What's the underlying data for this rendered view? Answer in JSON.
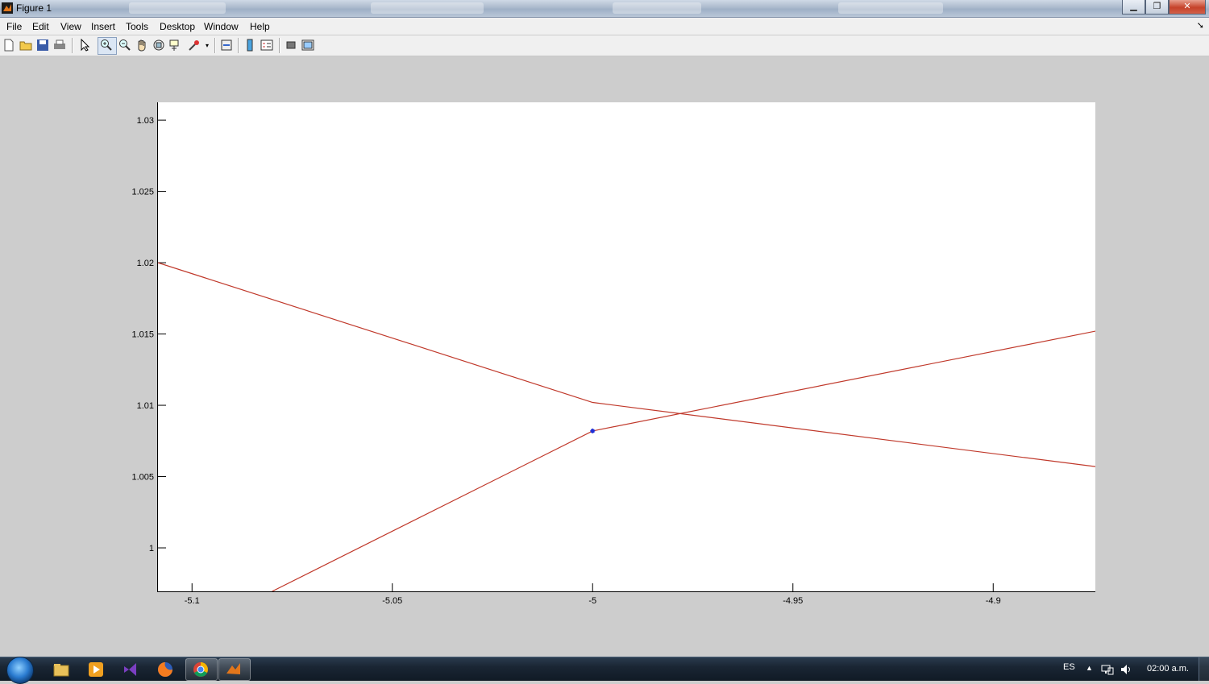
{
  "window": {
    "title": "Figure 1",
    "controls": {
      "minimize_icon": "minimize-icon",
      "maximize_icon": "restore-icon",
      "close_icon": "close-icon"
    }
  },
  "menu": {
    "items": [
      "File",
      "Edit",
      "View",
      "Insert",
      "Tools",
      "Desktop",
      "Window",
      "Help"
    ],
    "dock_icon": "dock-arrow-icon"
  },
  "toolbar": {
    "buttons": [
      "new-figure-icon",
      "open-file-icon",
      "save-icon",
      "print-icon",
      "edit-plot-arrow-icon",
      "zoom-in-icon",
      "zoom-out-icon",
      "pan-hand-icon",
      "rotate-3d-icon",
      "data-cursor-icon",
      "brush-icon",
      "link-plot-icon",
      "insert-colorbar-icon",
      "insert-legend-icon",
      "hide-plot-tools-icon",
      "show-plot-tools-icon"
    ],
    "active_tool": "zoom-in-icon"
  },
  "colors": {
    "line": "#c0392b",
    "marker": "#1f2fd6",
    "figure_bg": "#cdcdcd",
    "axes_bg": "#ffffff"
  },
  "chart_data": {
    "type": "line",
    "title": "",
    "xlabel": "",
    "ylabel": "",
    "xlim": [
      -5.1085,
      -4.8745
    ],
    "ylim": [
      0.99695,
      1.03125
    ],
    "xticks": [
      -5.1,
      -5.05,
      -5,
      -4.95,
      -4.9
    ],
    "xtick_labels": [
      "-5.1",
      "-5.05",
      "-5",
      "-4.95",
      "-4.9"
    ],
    "yticks": [
      1,
      1.005,
      1.01,
      1.015,
      1.02,
      1.025,
      1.03
    ],
    "ytick_labels": [
      "1",
      "1.005",
      "1.01",
      "1.015",
      "1.02",
      "1.025",
      "1.03"
    ],
    "grid": false,
    "series": [
      {
        "x": [
          -5.1085,
          -5.0,
          -4.8745
        ],
        "y": [
          1.02,
          1.0102,
          1.0057
        ]
      },
      {
        "x": [
          -5.08,
          -5.0,
          -4.8745
        ],
        "y": [
          0.99695,
          1.0082,
          1.0152
        ]
      }
    ],
    "markers": [
      {
        "x": -5.0,
        "y": 1.0082,
        "symbol": "*"
      }
    ]
  },
  "taskbar": {
    "start_icon": "windows-start-icon",
    "apps": [
      "file-explorer-icon",
      "media-player-icon",
      "visual-studio-icon",
      "firefox-icon",
      "chrome-icon",
      "matlab-icon"
    ],
    "language": "ES",
    "tray_icons": [
      "tray-expand-icon",
      "network-icon",
      "volume-icon"
    ],
    "clock": "02:00 a.m."
  }
}
